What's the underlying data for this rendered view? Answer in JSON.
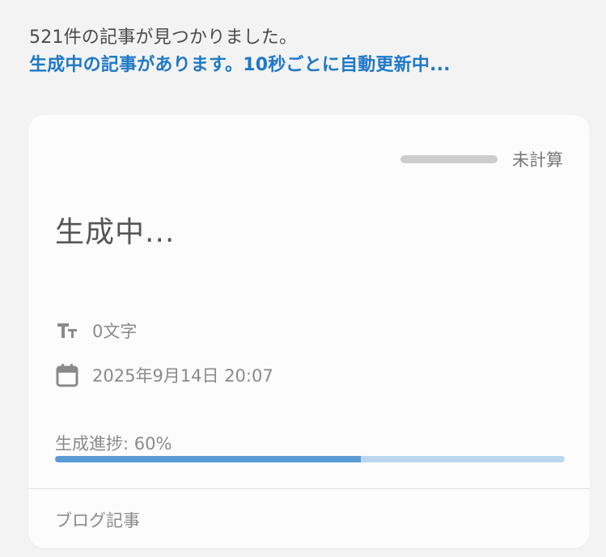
{
  "header": {
    "count_text": "521件の記事が見つかりました。",
    "status_text": "生成中の記事があります。10秒ごとに自動更新中..."
  },
  "card": {
    "score_label": "未計算",
    "title": "生成中...",
    "word_count": "0文字",
    "date": "2025年9月14日 20:07",
    "progress_label": "生成進捗: 60%",
    "progress_percent": 60,
    "category": "ブログ記事",
    "colors": {
      "accent": "#1f78c8",
      "progress_fill": "#5a9bd6",
      "progress_track": "#bcd6ef",
      "score_bar": "#cdcdcd"
    },
    "icons": {
      "word_count": "text-size-icon",
      "date": "calendar-icon"
    }
  }
}
